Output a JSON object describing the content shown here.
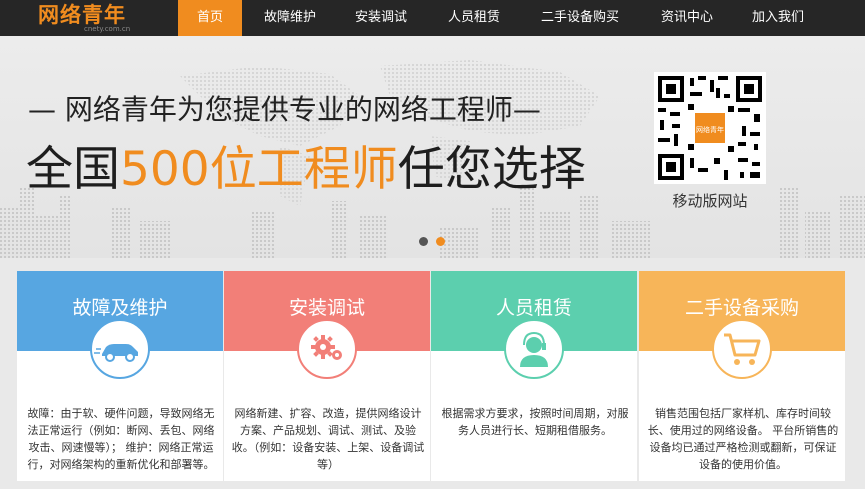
{
  "nav": {
    "logo_text": "网络青年",
    "logo_sub": "cnety.com.cn",
    "items": [
      {
        "label": "首页"
      },
      {
        "label": "故障维护"
      },
      {
        "label": "安装调试"
      },
      {
        "label": "人员租赁"
      },
      {
        "label": "二手设备购买"
      },
      {
        "label": "资讯中心"
      },
      {
        "label": "加入我们"
      }
    ]
  },
  "banner": {
    "slogan_line1": "— 网络青年为您提供专业的网络工程师—",
    "slogan_prefix": "全国",
    "slogan_highlight": "500位工程师",
    "slogan_suffix": "任您选择",
    "qr_center_text": "网络青年",
    "qr_label": "移动版网站"
  },
  "colors": {
    "accent": "#f08c1f",
    "nav_bg": "#262626",
    "card_blue": "#57a6e1",
    "card_red": "#f27f78",
    "card_green": "#5ccfae",
    "card_orange": "#f7b559"
  },
  "cards": [
    {
      "title": "故障及维护",
      "icon": "car-icon",
      "text": "故障：由于软、硬件问题，导致网络无法正常运行（例如：断网、丢包、网络攻击、网速慢等）； 维护：网络正常运行，对网络架构的重新优化和部署等。"
    },
    {
      "title": "安装调试",
      "icon": "gears-icon",
      "text": "网络新建、扩容、改造，提供网络设计方案、产品规划、调试、测试、及验收。（例如：设备安装、上架、设备调试等）"
    },
    {
      "title": "人员租赁",
      "icon": "headset-person-icon",
      "text": "根据需求方要求，按照时间周期，对服务人员进行长、短期租借服务。"
    },
    {
      "title": "二手设备采购",
      "icon": "shopping-cart-icon",
      "text": "销售范围包括厂家样机、库存时间较长、使用过的网络设备。 平台所销售的设备均已通过严格检测或翻新，可保证设备的使用价值。"
    }
  ]
}
